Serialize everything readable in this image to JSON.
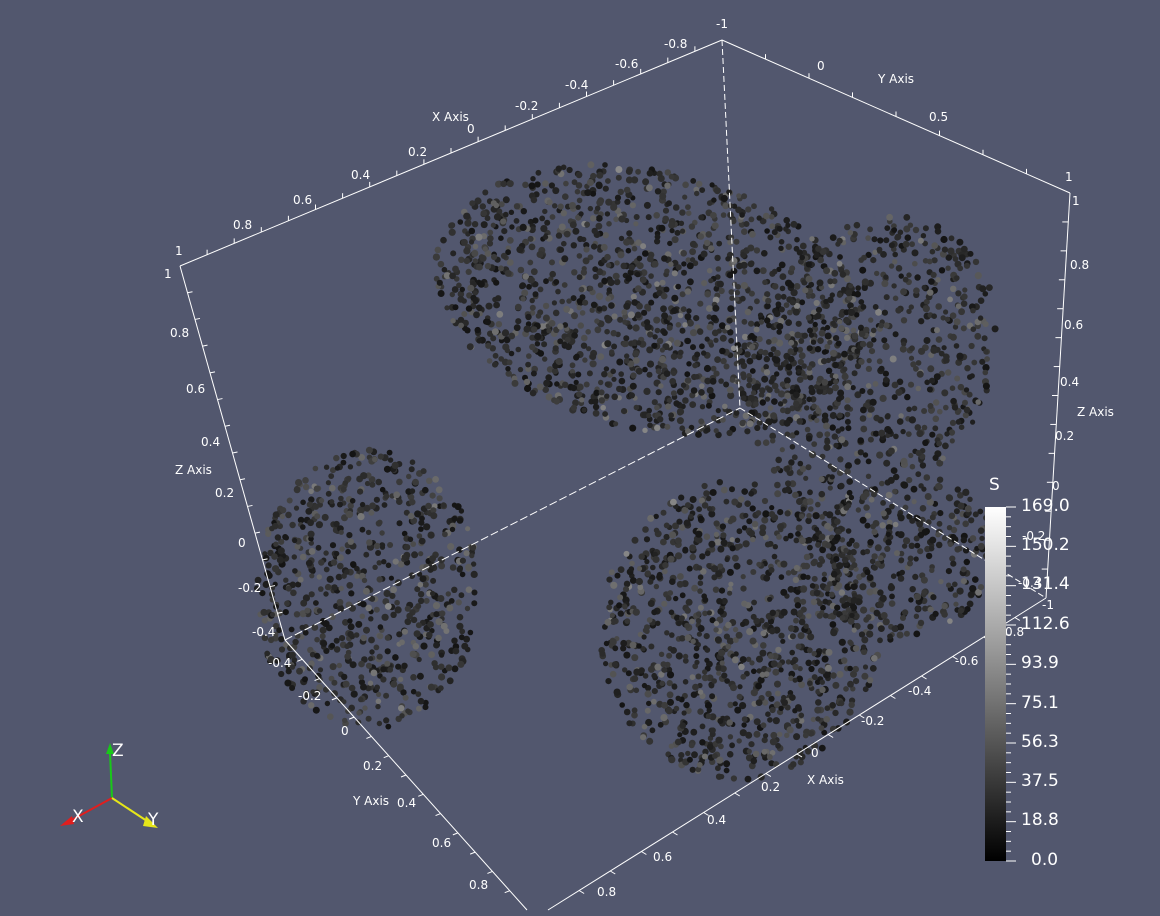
{
  "scene": {
    "background": "#52576e",
    "line_color": "#ffffff",
    "title_axes": {
      "x": "X Axis",
      "y": "Y Axis",
      "z": "Z Axis"
    },
    "top_x_ticks": [
      "-0.8",
      "-0.6",
      "-0.4",
      "-0.2",
      "0",
      "0.2",
      "0.4",
      "0.6",
      "0.8",
      "1"
    ],
    "top_corner_label": "-1",
    "top_y_ticks": [
      "0",
      "0.5",
      "1"
    ],
    "left_z_ticks": [
      "1",
      "0.8",
      "0.6",
      "0.4",
      "0.2",
      "0",
      "-0.2",
      "-0.4"
    ],
    "right_z_ticks": [
      "1",
      "0.8",
      "0.6",
      "0.4",
      "0.2",
      "0",
      "-0.2",
      "-0.4"
    ],
    "right_z_corner": "-1",
    "bottom_y_ticks": [
      "-0.4",
      "-0.2",
      "0",
      "0.2",
      "0.4",
      "0.6",
      "0.8"
    ],
    "bottom_x_ticks": [
      "-0.6",
      "-0.4",
      "-0.2",
      "0",
      "0.2",
      "0.4",
      "0.6",
      "0.8"
    ],
    "extra_tick": "0.8"
  },
  "scalar_bar": {
    "title": "S",
    "labels": [
      "169.0",
      "150.2",
      "131.4",
      "112.6",
      "93.9",
      "75.1",
      "56.3",
      "37.5",
      "18.8",
      "0.0"
    ],
    "color_high": "#ffffff",
    "color_low": "#000000"
  },
  "orientation_axes": {
    "z_label": "Z",
    "x_label": "X",
    "y_label": "Y",
    "z_color": "#19c819",
    "x_color": "#e01e1e",
    "y_color": "#e6e619"
  }
}
